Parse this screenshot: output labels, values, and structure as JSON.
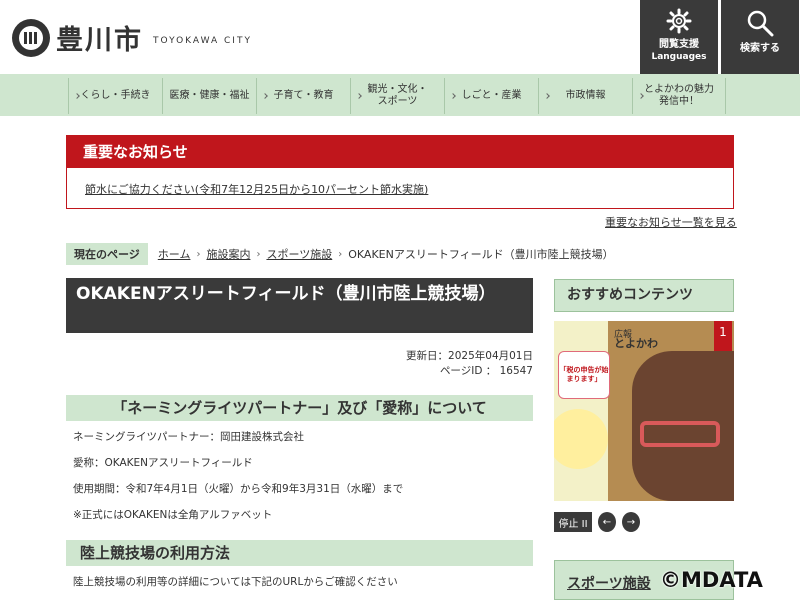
{
  "header": {
    "logo_name": "豊川市",
    "logo_sub": "TOYOKAWA CITY",
    "lang_button": {
      "line1": "閲覧支援",
      "line2": "Languages"
    },
    "search_button": {
      "label": "検索する"
    }
  },
  "nav": {
    "items": [
      "くらし・手続き",
      "医療・健康・福祉",
      "子育て・教育",
      "観光・文化・\nスポーツ",
      "しごと・産業",
      "市政情報",
      "とよかわの魅力\n発信中！"
    ]
  },
  "notice": {
    "heading": "重要なお知らせ",
    "link": "節水にご協力ください(令和7年12月25日から10パーセント節水実施)",
    "all_link": "重要なお知らせ一覧を見る"
  },
  "breadcrumb": {
    "here_label": "現在のページ",
    "items": [
      "ホーム",
      "施設案内",
      "スポーツ施設"
    ],
    "current": "OKAKENアスリートフィールド（豊川市陸上競技場）"
  },
  "main": {
    "title": "OKAKENアスリートフィールド（豊川市陸上競技場）",
    "updated": "更新日：2025年04月01日",
    "page_id": "ページID ： 16547",
    "section1": {
      "heading": "「ネーミングライツパートナー」及び「愛称」について",
      "lines": [
        "ネーミングライツパートナー：岡田建設株式会社",
        "愛称：OKAKENアスリートフィールド",
        "使用期間：令和7年4月1日（火曜）から令和9年3月31日（水曜）まで",
        "※正式にはOKAKENは全角アルファベット"
      ]
    },
    "section2": {
      "heading": "陸上競技場の利用方法",
      "lines": [
        "陸上競技場の利用等の詳細については下記のURLからご確認ください"
      ]
    }
  },
  "sidebar": {
    "recommend_heading": "おすすめコンテンツ",
    "banner": {
      "title": "広報",
      "magazine": "とよかわ",
      "issue": "1",
      "callout": "「税の申告が始まります」"
    },
    "controls": {
      "pause": "停止 II",
      "prev": "←",
      "next": "→"
    },
    "sports_heading": "スポーツ施設"
  },
  "watermark": "©MDATA",
  "colors": {
    "accent_red": "#c0161c",
    "nav_green": "#cfe6cf",
    "dark": "#3a3a3a"
  }
}
